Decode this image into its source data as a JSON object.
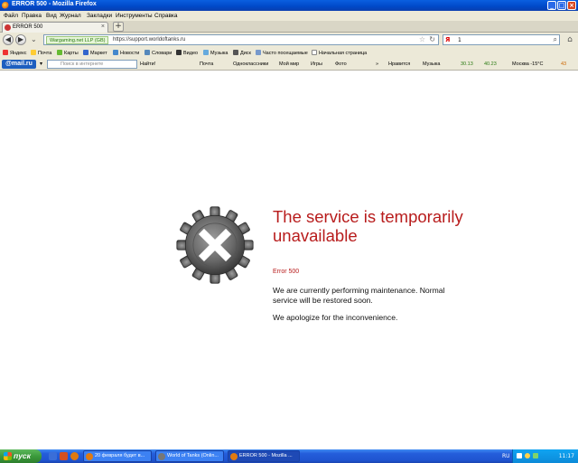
{
  "window": {
    "title": "ERROR 500 - Mozilla Firefox"
  },
  "menu": [
    "Файл",
    "Правка",
    "Вид",
    "Журнал",
    "Закладки",
    "Инструменты",
    "Справка"
  ],
  "tab": {
    "label": "ERROR 500",
    "close": "×",
    "new": "+"
  },
  "nav": {
    "identity": "Wargaming.net LLP (GB)",
    "url": "https://support.worldoftanks.ru",
    "search_query": "1",
    "search_brand": "Я"
  },
  "bookmarks": [
    "Яндекс",
    "Почта",
    "Карты",
    "Маркет",
    "Новости",
    "Словари",
    "Видео",
    "Музыка",
    "Диск",
    "Часто посещаемые",
    "Начальная страница"
  ],
  "mailbar": {
    "logo": "@mail.ru",
    "search_placeholder": "Поиск в интернете",
    "find": "Найти!",
    "items": [
      "Почта",
      "Одноклассники",
      "Мой мир",
      "Игры",
      "Фото"
    ],
    "more": "»",
    "right": [
      "Нравится",
      "Музыка",
      "30.13",
      "40.23",
      "Москва -15°C",
      "43"
    ]
  },
  "error": {
    "title": "The service is temporarily unavailable",
    "code": "Error 500",
    "message1": "We are currently performing maintenance. Normal service will be restored soon.",
    "message2": "We apologize for the inconvenience."
  },
  "taskbar": {
    "start": "пуск",
    "tasks": [
      "20 февраля будет в...",
      "World of Tanks (Onlin...",
      "ERROR 500 - Mozilla ..."
    ],
    "lang": "RU",
    "clock": "11:17"
  },
  "colors": {
    "error_red": "#b81c1c",
    "titlebar_blue": "#0048c8",
    "taskbar_blue": "#245edb"
  }
}
